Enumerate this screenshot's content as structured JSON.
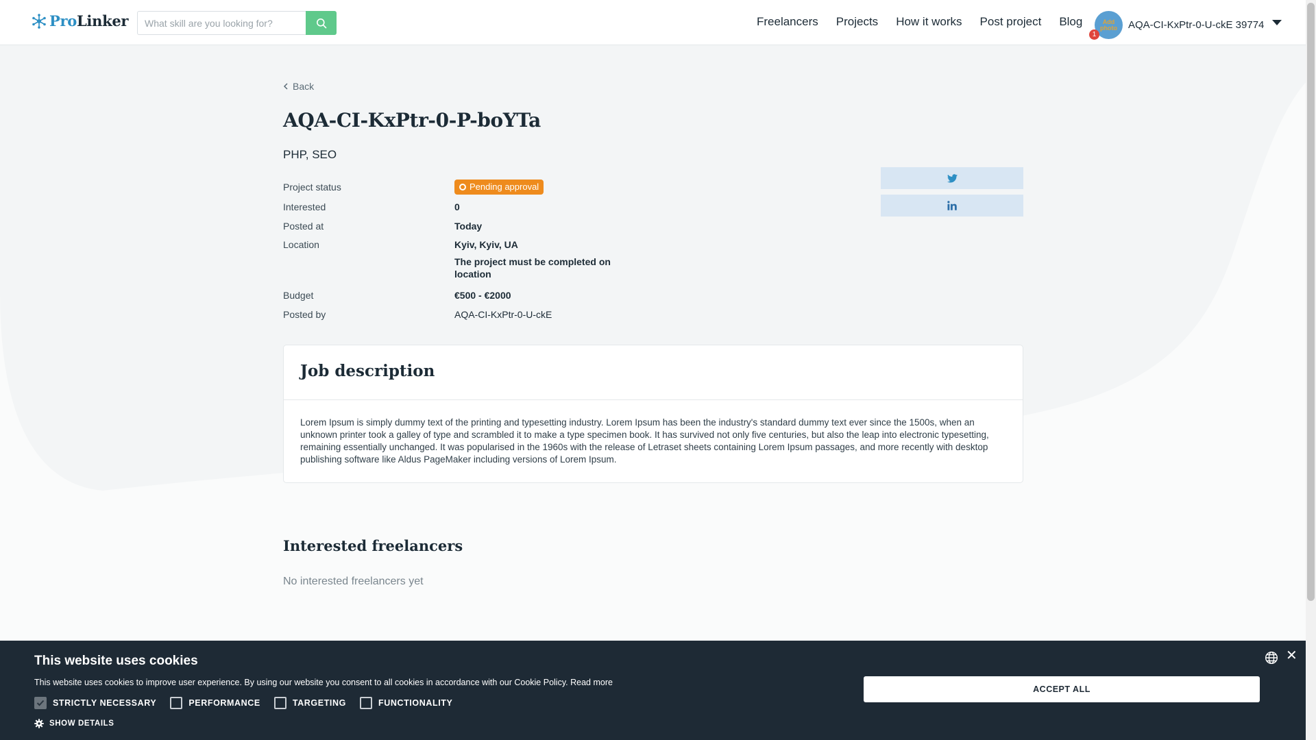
{
  "header": {
    "logo_pro": "Pro",
    "logo_linker": "Linker",
    "search_placeholder": "What skill are you looking for?",
    "nav": [
      "Freelancers",
      "Projects",
      "How it works",
      "Post project",
      "Blog"
    ],
    "avatar_text": "Add photo",
    "notification_count": "1",
    "user_name": "AQA-CI-KxPtr-0-U-ckE 39774"
  },
  "project": {
    "back_label": "Back",
    "title": "AQA-CI-KxPtr-0-P-boYTa",
    "skills": "PHP, SEO",
    "status_label": "Project status",
    "status_value": "Pending approval",
    "interested_label": "Interested",
    "interested_value": "0",
    "posted_at_label": "Posted at",
    "posted_at_value": "Today",
    "location_label": "Location",
    "location_value": "Kyiv, Kyiv, UA",
    "location_note": "The project must be completed on location",
    "budget_label": "Budget",
    "budget_value": "€500 - €2000",
    "posted_by_label": "Posted by",
    "posted_by_value": "AQA-CI-KxPtr-0-U-ckE"
  },
  "description": {
    "title": "Job description",
    "text": "Lorem Ipsum is simply dummy text of the printing and typesetting industry. Lorem Ipsum has been the industry's standard dummy text ever since the 1500s, when an unknown printer took a galley of type and scrambled it to make a type specimen book. It has survived not only five centuries, but also the leap into electronic typesetting, remaining essentially unchanged. It was popularised in the 1960s with the release of Letraset sheets containing Lorem Ipsum passages, and more recently with desktop publishing software like Aldus PageMaker including versions of Lorem Ipsum."
  },
  "interested": {
    "title": "Interested freelancers",
    "empty": "No interested freelancers yet"
  },
  "cookie": {
    "title": "This website uses cookies",
    "text": "This website uses cookies to improve user experience. By using our website you consent to all cookies in accordance with our Cookie Policy.",
    "read_more": "Read more",
    "options": [
      "STRICTLY NECESSARY",
      "PERFORMANCE",
      "TARGETING",
      "FUNCTIONALITY"
    ],
    "show_details": "SHOW DETAILS",
    "accept": "ACCEPT ALL"
  },
  "colors": {
    "brand_blue": "#2d8fc4",
    "search_green": "#5fc98b",
    "status_orange": "#ee8b1d",
    "share_bg": "#d8e6f3",
    "cookie_bg": "#1e2a35"
  },
  "icons": [
    "logo-icon",
    "search-icon",
    "chevron-left-icon",
    "twitter-icon",
    "linkedin-icon",
    "gear-icon",
    "globe-icon",
    "close-icon"
  ]
}
